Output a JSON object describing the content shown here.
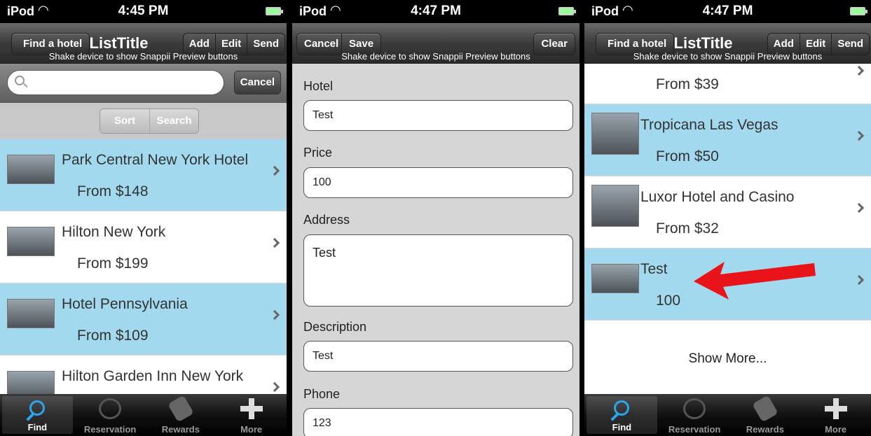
{
  "status": {
    "carrier": "iPod",
    "time_1": "4:45 PM",
    "time_2": "4:47 PM",
    "time_3": "4:47 PM"
  },
  "screen1": {
    "nav": {
      "back": "Find a hotel",
      "title": "ListTitle",
      "add": "Add",
      "edit": "Edit",
      "send": "Send",
      "subtitle": "Shake device to show Snappii Preview buttons"
    },
    "search": {
      "placeholder": "",
      "cancel": "Cancel"
    },
    "scope": {
      "sort": "Sort",
      "search": "Search"
    },
    "rows": [
      {
        "name": "Park Central New York Hotel",
        "price": "From $148",
        "highlight": true
      },
      {
        "name": "Hilton New York",
        "price": "From $199",
        "highlight": false
      },
      {
        "name": "Hotel Pennsylvania",
        "price": "From $109",
        "highlight": true
      },
      {
        "name": "Hilton Garden Inn New York",
        "price": "",
        "highlight": false
      }
    ]
  },
  "screen2": {
    "nav": {
      "cancel": "Cancel",
      "save": "Save",
      "clear": "Clear",
      "subtitle": "Shake device to show Snappii Preview buttons"
    },
    "fields": [
      {
        "label": "Hotel",
        "value": "Test"
      },
      {
        "label": "Price",
        "value": "100"
      },
      {
        "label": "Address",
        "value": "Test"
      },
      {
        "label": "Description",
        "value": "Test"
      },
      {
        "label": "Phone",
        "value": "123"
      }
    ]
  },
  "screen3": {
    "nav": {
      "back": "Find a hotel",
      "title": "ListTitle",
      "add": "Add",
      "edit": "Edit",
      "send": "Send",
      "subtitle": "Shake device to show Snappii Preview buttons"
    },
    "rows": [
      {
        "name": "",
        "price": "From $39",
        "highlight": false
      },
      {
        "name": "Tropicana Las Vegas",
        "price": "From $50",
        "highlight": true
      },
      {
        "name": "Luxor Hotel and Casino",
        "price": "From $32",
        "highlight": false
      },
      {
        "name": "Test",
        "price": "100",
        "highlight": true
      }
    ],
    "show_more": "Show More..."
  },
  "tabbar": {
    "find": "Find",
    "reservation": "Reservation",
    "rewards": "Rewards",
    "more": "More"
  },
  "colors": {
    "highlight_row": "#a3d9ee",
    "accent": "#2aa6ea",
    "arrow": "#e8141a"
  }
}
